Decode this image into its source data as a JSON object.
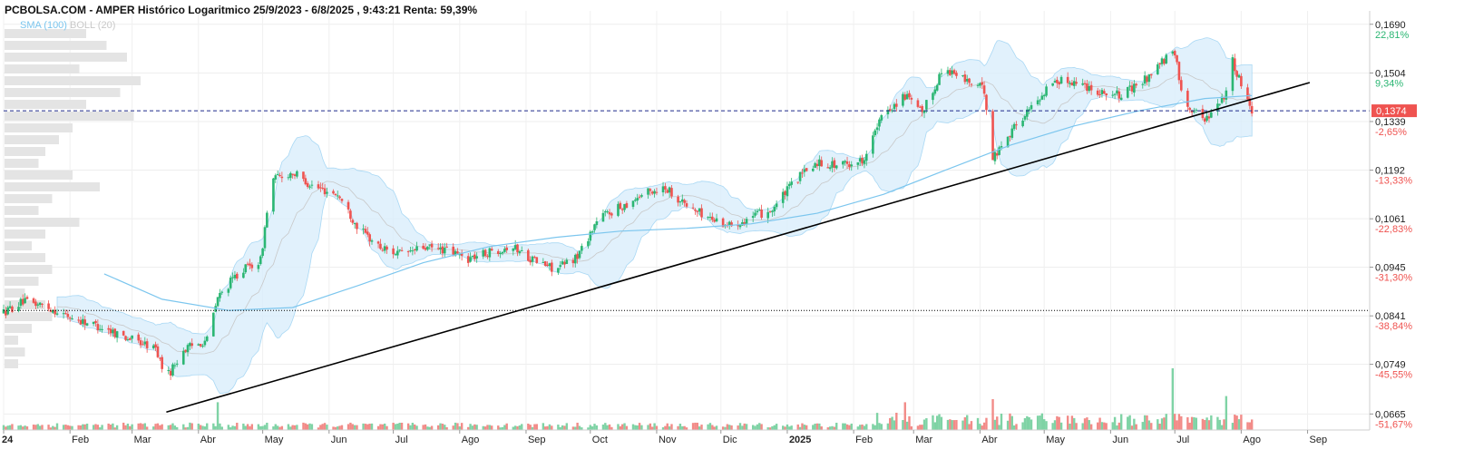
{
  "header": {
    "title": "PCBOLSA.COM - AMPER Histórico Logaritmico 25/9/2023 - 6/8/2025 , 9:43:21 Renta: 59,39%"
  },
  "legend": {
    "sma": "SMA (100)",
    "boll": "BOLL (20)"
  },
  "colors": {
    "up": "#2bb673",
    "down": "#ef5350",
    "sma": "#7cc6ee",
    "band_fill": "#d9eefb",
    "band_line": "#a9d8f4",
    "mid_line": "#c8c8c8",
    "volume_profile": "#e4e4e4",
    "trendline": "#000000",
    "current_line": "#1f2a8a",
    "support_line": "#000000",
    "price_badge": "#ef5350"
  },
  "chart_data": {
    "type": "candlestick",
    "title": "PCBOLSA.COM - AMPER Histórico Logaritmico 25/9/2023 - 6/8/2025 , 9:43:21 Renta: 59,39%",
    "scale": "log",
    "ylim": [
      0.064,
      0.1745
    ],
    "x_range": [
      "2024-01-01",
      "2025-09-30"
    ],
    "grid": true,
    "month_ticks": [
      {
        "label": "24",
        "date": "2024-01-01"
      },
      {
        "label": "Feb",
        "date": "2024-02-01"
      },
      {
        "label": "Mar",
        "date": "2024-03-01"
      },
      {
        "label": "Abr",
        "date": "2024-04-01"
      },
      {
        "label": "May",
        "date": "2024-05-01"
      },
      {
        "label": "Jun",
        "date": "2024-06-01"
      },
      {
        "label": "Jul",
        "date": "2024-07-01"
      },
      {
        "label": "Ago",
        "date": "2024-08-01"
      },
      {
        "label": "Sep",
        "date": "2024-09-01"
      },
      {
        "label": "Oct",
        "date": "2024-10-01"
      },
      {
        "label": "Nov",
        "date": "2024-11-01"
      },
      {
        "label": "Dic",
        "date": "2024-12-01"
      },
      {
        "label": "2025",
        "date": "2025-01-01"
      },
      {
        "label": "Feb",
        "date": "2025-02-01"
      },
      {
        "label": "Mar",
        "date": "2025-03-01"
      },
      {
        "label": "Abr",
        "date": "2025-04-01"
      },
      {
        "label": "May",
        "date": "2025-05-01"
      },
      {
        "label": "Jun",
        "date": "2025-06-01"
      },
      {
        "label": "Jul",
        "date": "2025-07-01"
      },
      {
        "label": "Ago",
        "date": "2025-08-01"
      },
      {
        "label": "Sep",
        "date": "2025-09-01"
      }
    ],
    "y_ticks": [
      {
        "value": 0.169,
        "label": "0,1690",
        "pct": "22,81%",
        "dir": "up"
      },
      {
        "value": 0.1504,
        "label": "0,1504",
        "pct": "9,34%",
        "dir": "up"
      },
      {
        "value": 0.1339,
        "label": "0,1339",
        "pct": "-2,65%",
        "dir": "down"
      },
      {
        "value": 0.1192,
        "label": "0,1192",
        "pct": "-13,33%",
        "dir": "down"
      },
      {
        "value": 0.1061,
        "label": "0,1061",
        "pct": "-22,83%",
        "dir": "down"
      },
      {
        "value": 0.0945,
        "label": "0,0945",
        "pct": "-31,30%",
        "dir": "down"
      },
      {
        "value": 0.0841,
        "label": "0,0841",
        "pct": "-38,84%",
        "dir": "down"
      },
      {
        "value": 0.0749,
        "label": "0,0749",
        "pct": "-45,55%",
        "dir": "down"
      },
      {
        "value": 0.0665,
        "label": "0,0665",
        "pct": "-51,67%",
        "dir": "down"
      }
    ],
    "current_price": {
      "value": 0.1374,
      "label": "0,1374"
    },
    "support_level": 0.0852,
    "trendline": [
      {
        "date": "2024-03-17",
        "value": 0.0668
      },
      {
        "date": "2025-09-02",
        "value": 0.147
      }
    ],
    "price_path": [
      {
        "date": "2024-01-01",
        "value": 0.0848
      },
      {
        "date": "2024-01-10",
        "value": 0.087
      },
      {
        "date": "2024-01-20",
        "value": 0.0862
      },
      {
        "date": "2024-02-01",
        "value": 0.0838
      },
      {
        "date": "2024-02-15",
        "value": 0.082
      },
      {
        "date": "2024-03-01",
        "value": 0.0795
      },
      {
        "date": "2024-03-12",
        "value": 0.0778
      },
      {
        "date": "2024-03-17",
        "value": 0.0725
      },
      {
        "date": "2024-03-25",
        "value": 0.0775
      },
      {
        "date": "2024-04-05",
        "value": 0.0795
      },
      {
        "date": "2024-04-10",
        "value": 0.0878
      },
      {
        "date": "2024-04-20",
        "value": 0.0935
      },
      {
        "date": "2024-04-30",
        "value": 0.096
      },
      {
        "date": "2024-05-05",
        "value": 0.1165
      },
      {
        "date": "2024-05-15",
        "value": 0.1185
      },
      {
        "date": "2024-05-25",
        "value": 0.1145
      },
      {
        "date": "2024-06-05",
        "value": 0.1125
      },
      {
        "date": "2024-06-15",
        "value": 0.1035
      },
      {
        "date": "2024-06-25",
        "value": 0.099
      },
      {
        "date": "2024-07-05",
        "value": 0.0975
      },
      {
        "date": "2024-07-15",
        "value": 0.099
      },
      {
        "date": "2024-07-25",
        "value": 0.0985
      },
      {
        "date": "2024-08-05",
        "value": 0.0965
      },
      {
        "date": "2024-08-15",
        "value": 0.098
      },
      {
        "date": "2024-08-25",
        "value": 0.0995
      },
      {
        "date": "2024-09-05",
        "value": 0.096
      },
      {
        "date": "2024-09-15",
        "value": 0.094
      },
      {
        "date": "2024-09-25",
        "value": 0.097
      },
      {
        "date": "2024-10-05",
        "value": 0.1065
      },
      {
        "date": "2024-10-15",
        "value": 0.109
      },
      {
        "date": "2024-10-25",
        "value": 0.1125
      },
      {
        "date": "2024-11-05",
        "value": 0.1145
      },
      {
        "date": "2024-11-15",
        "value": 0.1095
      },
      {
        "date": "2024-11-25",
        "value": 0.1065
      },
      {
        "date": "2024-12-05",
        "value": 0.1045
      },
      {
        "date": "2024-12-15",
        "value": 0.1065
      },
      {
        "date": "2024-12-25",
        "value": 0.1085
      },
      {
        "date": "2025-01-05",
        "value": 0.1165
      },
      {
        "date": "2025-01-15",
        "value": 0.1215
      },
      {
        "date": "2025-01-25",
        "value": 0.1205
      },
      {
        "date": "2025-02-05",
        "value": 0.122
      },
      {
        "date": "2025-02-15",
        "value": 0.1365
      },
      {
        "date": "2025-02-25",
        "value": 0.1425
      },
      {
        "date": "2025-03-05",
        "value": 0.1365
      },
      {
        "date": "2025-03-15",
        "value": 0.1525
      },
      {
        "date": "2025-03-25",
        "value": 0.148
      },
      {
        "date": "2025-04-03",
        "value": 0.1445
      },
      {
        "date": "2025-04-07",
        "value": 0.1225
      },
      {
        "date": "2025-04-15",
        "value": 0.1305
      },
      {
        "date": "2025-04-25",
        "value": 0.1385
      },
      {
        "date": "2025-05-05",
        "value": 0.1475
      },
      {
        "date": "2025-05-15",
        "value": 0.1475
      },
      {
        "date": "2025-05-25",
        "value": 0.1445
      },
      {
        "date": "2025-06-05",
        "value": 0.1425
      },
      {
        "date": "2025-06-15",
        "value": 0.1465
      },
      {
        "date": "2025-06-25",
        "value": 0.1545
      },
      {
        "date": "2025-07-01",
        "value": 0.1575
      },
      {
        "date": "2025-07-05",
        "value": 0.1405
      },
      {
        "date": "2025-07-15",
        "value": 0.1345
      },
      {
        "date": "2025-07-25",
        "value": 0.1435
      },
      {
        "date": "2025-07-28",
        "value": 0.1545
      },
      {
        "date": "2025-08-06",
        "value": 0.1374
      }
    ],
    "sma_path": [
      {
        "date": "2024-02-17",
        "value": 0.093
      },
      {
        "date": "2024-03-15",
        "value": 0.0875
      },
      {
        "date": "2024-04-15",
        "value": 0.0852
      },
      {
        "date": "2024-05-15",
        "value": 0.0858
      },
      {
        "date": "2024-06-15",
        "value": 0.0905
      },
      {
        "date": "2024-07-15",
        "value": 0.0955
      },
      {
        "date": "2024-08-15",
        "value": 0.0993
      },
      {
        "date": "2024-09-15",
        "value": 0.1015
      },
      {
        "date": "2024-10-15",
        "value": 0.103
      },
      {
        "date": "2024-11-15",
        "value": 0.1037
      },
      {
        "date": "2024-12-15",
        "value": 0.1048
      },
      {
        "date": "2025-01-15",
        "value": 0.1075
      },
      {
        "date": "2025-02-15",
        "value": 0.1125
      },
      {
        "date": "2025-03-15",
        "value": 0.119
      },
      {
        "date": "2025-04-15",
        "value": 0.1265
      },
      {
        "date": "2025-05-15",
        "value": 0.1325
      },
      {
        "date": "2025-06-15",
        "value": 0.1375
      },
      {
        "date": "2025-07-15",
        "value": 0.1415
      },
      {
        "date": "2025-08-06",
        "value": 0.1425
      }
    ],
    "volume_spikes": [
      {
        "date": "2024-04-10",
        "value": 0.45
      },
      {
        "date": "2025-04-07",
        "value": 0.5
      },
      {
        "date": "2025-06-30",
        "value": 1.0
      },
      {
        "date": "2025-07-25",
        "value": 0.55
      },
      {
        "date": "2025-02-25",
        "value": 0.45
      }
    ]
  }
}
